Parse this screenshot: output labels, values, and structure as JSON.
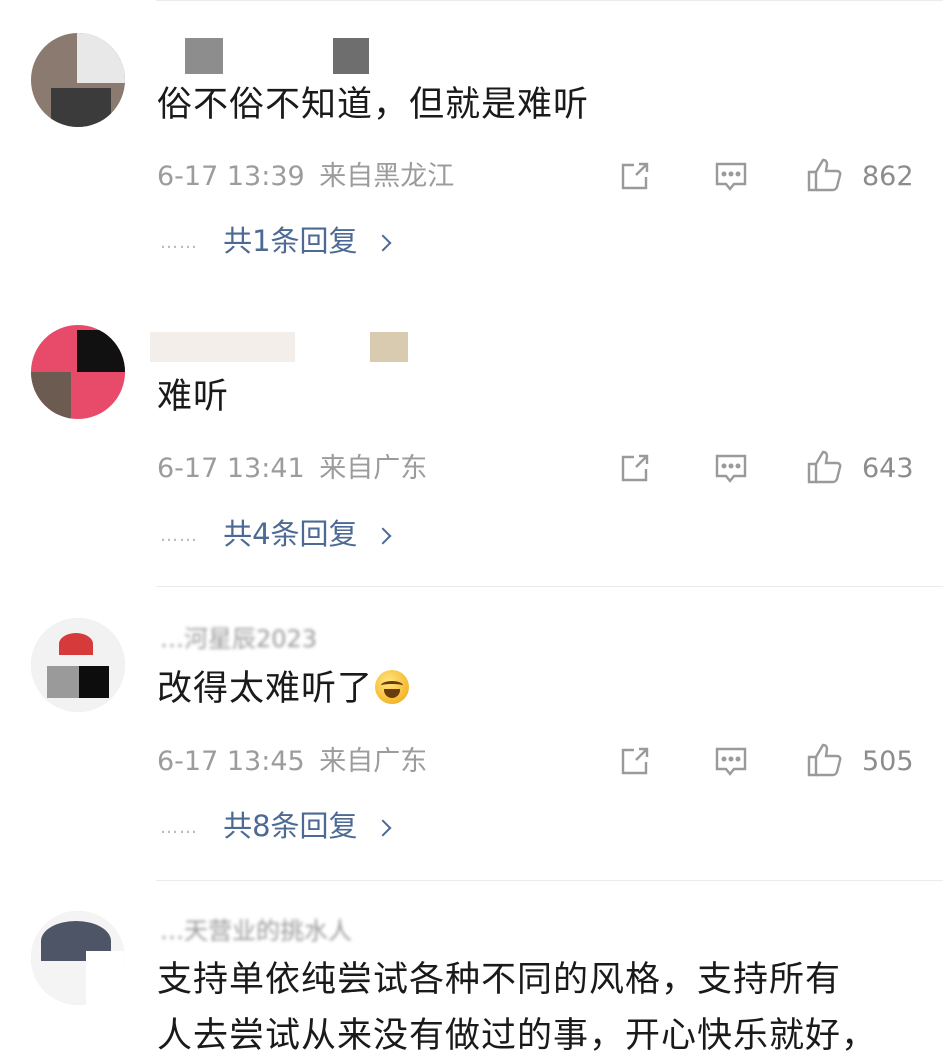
{
  "comments": [
    {
      "username": "",
      "content": "俗不俗不知道，但就是难听",
      "time": "6-17 13:39",
      "location": "来自黑龙江",
      "likes": "862",
      "replies": "共1条回复",
      "dots": "……"
    },
    {
      "username": "",
      "content": "难听",
      "time": "6-17 13:41",
      "location": "来自广东",
      "likes": "643",
      "replies": "共4条回复",
      "dots": "……"
    },
    {
      "username": "…河星辰2023",
      "content": "改得太难听了",
      "time": "6-17 13:45",
      "location": "来自广东",
      "likes": "505",
      "replies": "共8条回复",
      "dots": "……"
    },
    {
      "username": "…天营业的挑水人",
      "content_line1": "支持单依纯尝试各种不同的风格，支持所有",
      "content_line2": "人去尝试从来没有做过的事，开心快乐就好，"
    }
  ],
  "icons": {
    "share": "share-icon",
    "comment": "comment-icon",
    "like": "thumbs-up-icon",
    "emoji": "laughing-crying-emoji"
  },
  "colors": {
    "text": "#1a1a1a",
    "meta": "#9c9c9c",
    "link": "#4d6a95",
    "divider": "#ebebeb"
  }
}
